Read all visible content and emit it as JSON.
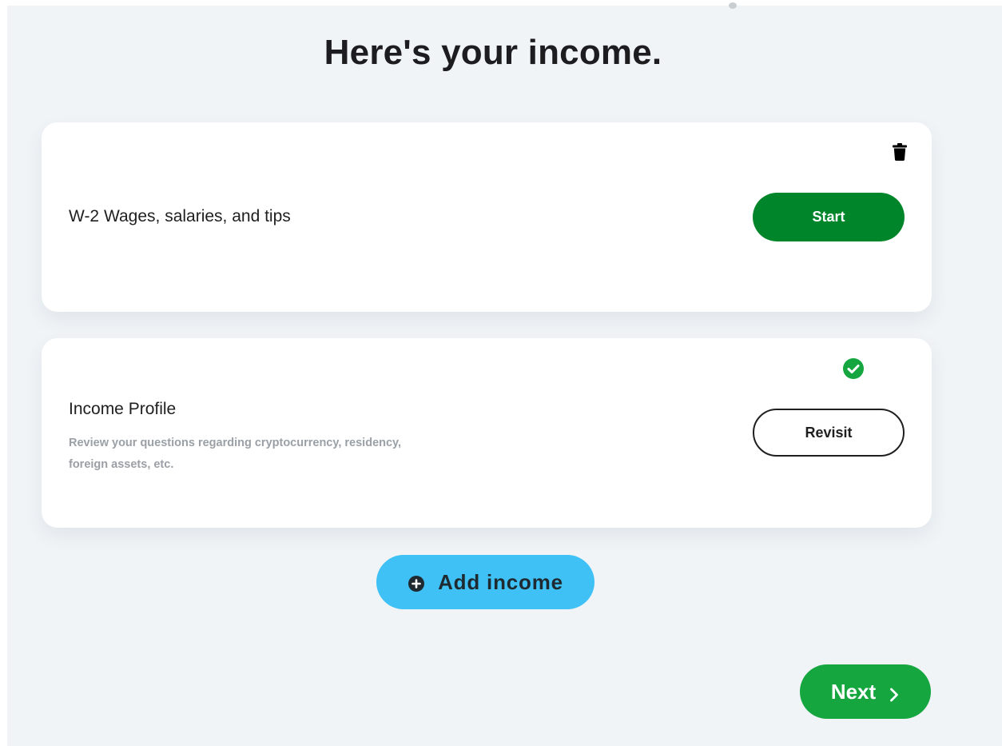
{
  "page": {
    "title": "Here's your income."
  },
  "income_items": [
    {
      "title": "W-2 Wages, salaries, and tips",
      "action_label": "Start",
      "status_icon": "trash-icon"
    },
    {
      "title": "Income Profile",
      "description": "Review your questions regarding cryptocurrency, residency, foreign assets, etc.",
      "action_label": "Revisit",
      "status_icon": "check-circle-icon"
    }
  ],
  "actions": {
    "add_income_label": "Add income",
    "add_income_icon": "plus-circle-icon",
    "next_label": "Next",
    "next_icon": "chevron-right-icon"
  },
  "colors": {
    "background": "#f0f4f7",
    "start_button": "#00852b",
    "next_button": "#16a640",
    "add_income_button": "#3fc1f6",
    "check": "#16a640"
  }
}
